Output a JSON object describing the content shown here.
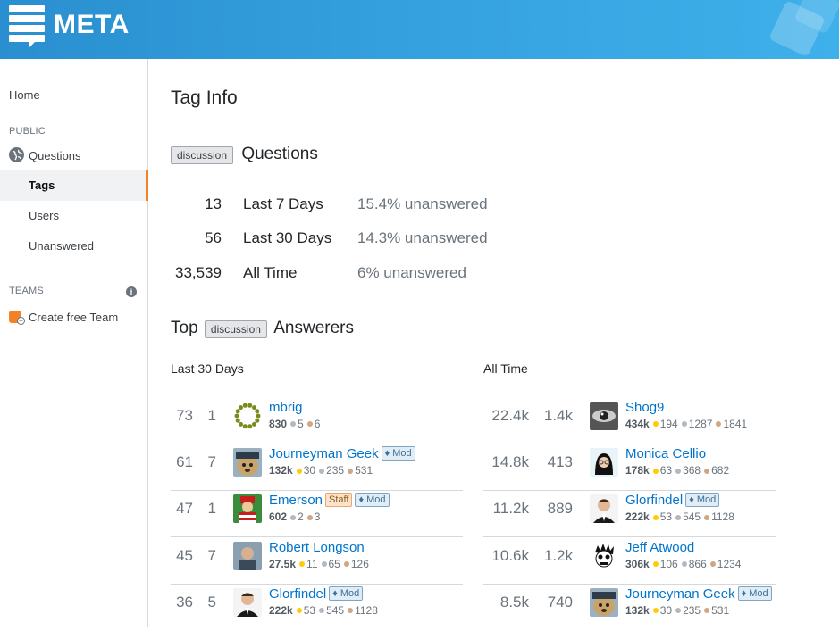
{
  "header": {
    "logo_text": "META"
  },
  "sidebar": {
    "home": "Home",
    "public_label": "PUBLIC",
    "questions": "Questions",
    "tags": "Tags",
    "users": "Users",
    "unanswered": "Unanswered",
    "teams_label": "TEAMS",
    "create_team": "Create free Team"
  },
  "main": {
    "title": "Tag Info",
    "tag_name": "discussion",
    "questions_heading": "Questions",
    "stats": [
      {
        "count": "13",
        "label": "Last 7 Days",
        "unanswered": "15.4% unanswered"
      },
      {
        "count": "56",
        "label": "Last 30 Days",
        "unanswered": "14.3% unanswered"
      },
      {
        "count": "33,539",
        "label": "All Time",
        "unanswered": "6% unanswered"
      }
    ],
    "top_word": "Top",
    "answerers_word": "Answerers",
    "last30_heading": "Last 30 Days",
    "alltime_heading": "All Time",
    "last30": [
      {
        "score": "73",
        "answers": "1",
        "name": "mbrig",
        "rep": "830",
        "gold": "",
        "silver": "5",
        "bronze": "6",
        "mod": "",
        "staff": ""
      },
      {
        "score": "61",
        "answers": "7",
        "name": "Journeyman Geek",
        "rep": "132k",
        "gold": "30",
        "silver": "235",
        "bronze": "531",
        "mod": "♦ Mod",
        "staff": ""
      },
      {
        "score": "47",
        "answers": "1",
        "name": "Emerson",
        "rep": "602",
        "gold": "",
        "silver": "2",
        "bronze": "3",
        "mod": "♦ Mod",
        "staff": "Staff"
      },
      {
        "score": "45",
        "answers": "7",
        "name": "Robert Longson",
        "rep": "27.5k",
        "gold": "11",
        "silver": "65",
        "bronze": "126",
        "mod": "",
        "staff": ""
      },
      {
        "score": "36",
        "answers": "5",
        "name": "Glorfindel",
        "rep": "222k",
        "gold": "53",
        "silver": "545",
        "bronze": "1128",
        "mod": "♦ Mod",
        "staff": ""
      }
    ],
    "alltime": [
      {
        "score": "22.4k",
        "answers": "1.4k",
        "name": "Shog9",
        "rep": "434k",
        "gold": "194",
        "silver": "1287",
        "bronze": "1841",
        "mod": "",
        "staff": ""
      },
      {
        "score": "14.8k",
        "answers": "413",
        "name": "Monica Cellio",
        "rep": "178k",
        "gold": "63",
        "silver": "368",
        "bronze": "682",
        "mod": "",
        "staff": ""
      },
      {
        "score": "11.2k",
        "answers": "889",
        "name": "Glorfindel",
        "rep": "222k",
        "gold": "53",
        "silver": "545",
        "bronze": "1128",
        "mod": "♦ Mod",
        "staff": ""
      },
      {
        "score": "10.6k",
        "answers": "1.2k",
        "name": "Jeff Atwood",
        "rep": "306k",
        "gold": "106",
        "silver": "866",
        "bronze": "1234",
        "mod": "",
        "staff": ""
      },
      {
        "score": "8.5k",
        "answers": "740",
        "name": "Journeyman Geek",
        "rep": "132k",
        "gold": "30",
        "silver": "235",
        "bronze": "531",
        "mod": "♦ Mod",
        "staff": ""
      }
    ]
  }
}
